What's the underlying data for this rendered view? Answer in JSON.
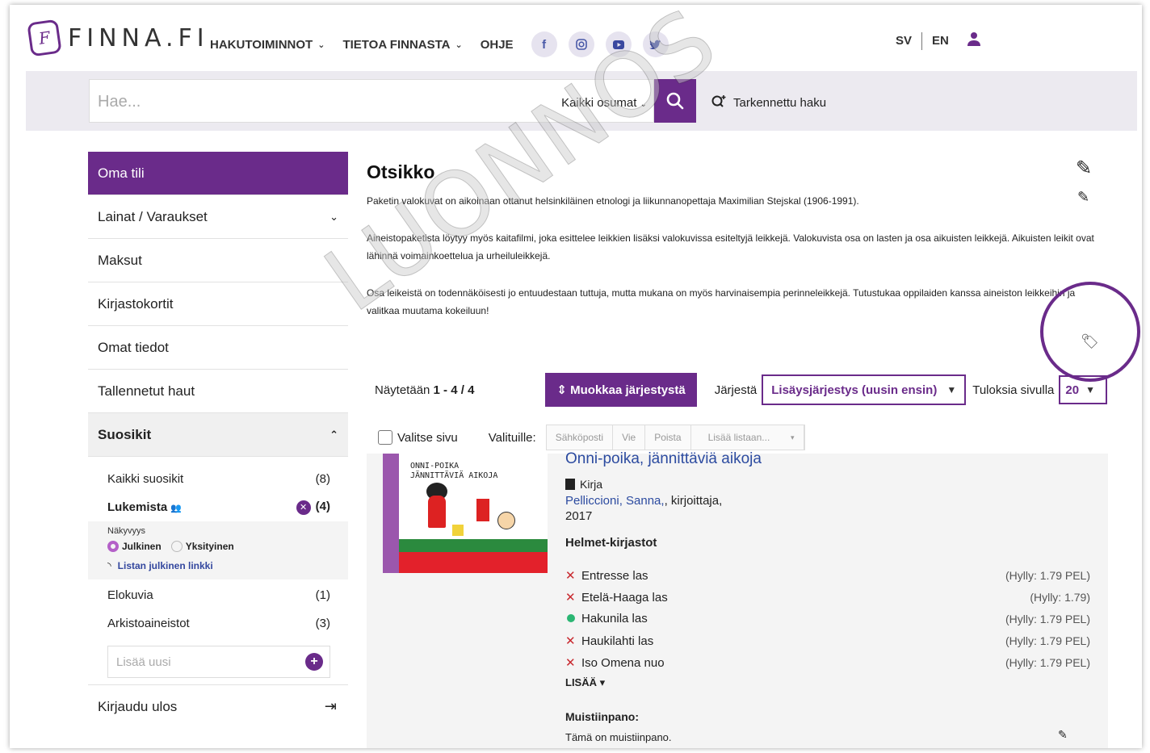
{
  "header": {
    "logo_text": "FINNA.FI",
    "nav": [
      {
        "label": "HAKUTOIMINNOT",
        "has_dropdown": true
      },
      {
        "label": "TIETOA FINNASTA",
        "has_dropdown": true
      },
      {
        "label": "OHJE",
        "has_dropdown": false
      }
    ],
    "social_icons": [
      "facebook-icon",
      "instagram-icon",
      "youtube-icon",
      "twitter-icon"
    ],
    "lang_sv": "SV",
    "lang_en": "EN"
  },
  "search": {
    "placeholder": "Hae...",
    "scope": "Kaikki osumat",
    "advanced": "Tarkennettu haku"
  },
  "sidebar": {
    "items": [
      {
        "label": "Oma tili"
      },
      {
        "label": "Lainat / Varaukset"
      },
      {
        "label": "Maksut"
      },
      {
        "label": "Kirjastokortit"
      },
      {
        "label": "Omat tiedot"
      },
      {
        "label": "Tallennetut haut"
      }
    ],
    "favorites": {
      "label": "Suosikit",
      "lists": [
        {
          "name": "Kaikki suosikit",
          "count": "(8)"
        },
        {
          "name": "Lukemista",
          "count": "(4)"
        }
      ],
      "visibility_title": "Näkyvyys",
      "visibility_public": "Julkinen",
      "visibility_private": "Yksityinen",
      "public_link": "Listan julkinen linkki",
      "other_lists": [
        {
          "name": "Elokuvia",
          "count": "(1)"
        },
        {
          "name": "Arkistoaineistot",
          "count": "(3)"
        }
      ],
      "add_placeholder": "Lisää uusi"
    },
    "logout": "Kirjaudu ulos"
  },
  "main": {
    "title": "Otsikko",
    "description": [
      "Paketin valokuvat on aikoinaan ottanut helsinkiläinen etnologi ja liikunnanopettaja Maximilian Stejskal (1906-1991).",
      "Aineistopaketista löytyy myös kaitafilmi, joka esittelee leikkien lisäksi valokuvissa esiteltyjä leikkejä. Valokuvista osa on lasten ja osa aikuisten leikkejä. Aikuisten leikit ovat lähinnä voimainkoettelua ja urheiluleikkejä.",
      "Osa leikeistä on todennäköisesti jo entuudestaan tuttuja, mutta mukana on myös harvinaisempia perinneleikkejä. Tutustukaa oppilaiden kanssa aineiston leikkeihin ja valitkaa muutama kokeiluun!"
    ],
    "watermark": "LUONNOS",
    "showing_prefix": "Näytetään ",
    "showing_range": "1 - 4 / 4",
    "reorder_button": "⇕ Muokkaa järjestystä",
    "sort_label": "Järjestä",
    "sort_value": "Lisäysjärjestys (uusin ensin)",
    "per_page_label": "Tuloksia sivulla",
    "per_page_value": "20",
    "select_page": "Valitse sivu",
    "selected_label": "Valituille:",
    "bulk_actions": [
      "Sähköposti",
      "Vie",
      "Poista",
      "Lisää listaan..."
    ]
  },
  "record": {
    "cover_title": "ONNI-POIKA JÄNNITTÄVIÄ AIKOJA",
    "title": "Onni-poika, jännittäviä aikoja",
    "format": "Kirja",
    "author_link": "Pelliccioni, Sanna,",
    "author_role": ", kirjoittaja,",
    "year": "2017",
    "library": "Helmet-kirjastot",
    "holdings": [
      {
        "name": "Entresse las",
        "available": false,
        "shelf": "(Hylly: 1.79 PEL)"
      },
      {
        "name": "Etelä-Haaga las",
        "available": false,
        "shelf": "(Hylly: 1.79)"
      },
      {
        "name": "Hakunila las",
        "available": true,
        "shelf": "(Hylly: 1.79 PEL)"
      },
      {
        "name": "Haukilahti las",
        "available": false,
        "shelf": "(Hylly: 1.79 PEL)"
      },
      {
        "name": "Iso Omena nuo",
        "available": false,
        "shelf": "(Hylly: 1.79 PEL)"
      }
    ],
    "more": "LISÄÄ ▾",
    "note_label": "Muistiinpano:",
    "note_text": "Tämä on muistiinpano."
  },
  "colors": {
    "accent": "#6a2b8a",
    "link": "#2c4ba0",
    "unavailable": "#c8282e",
    "available": "#2bb673"
  }
}
